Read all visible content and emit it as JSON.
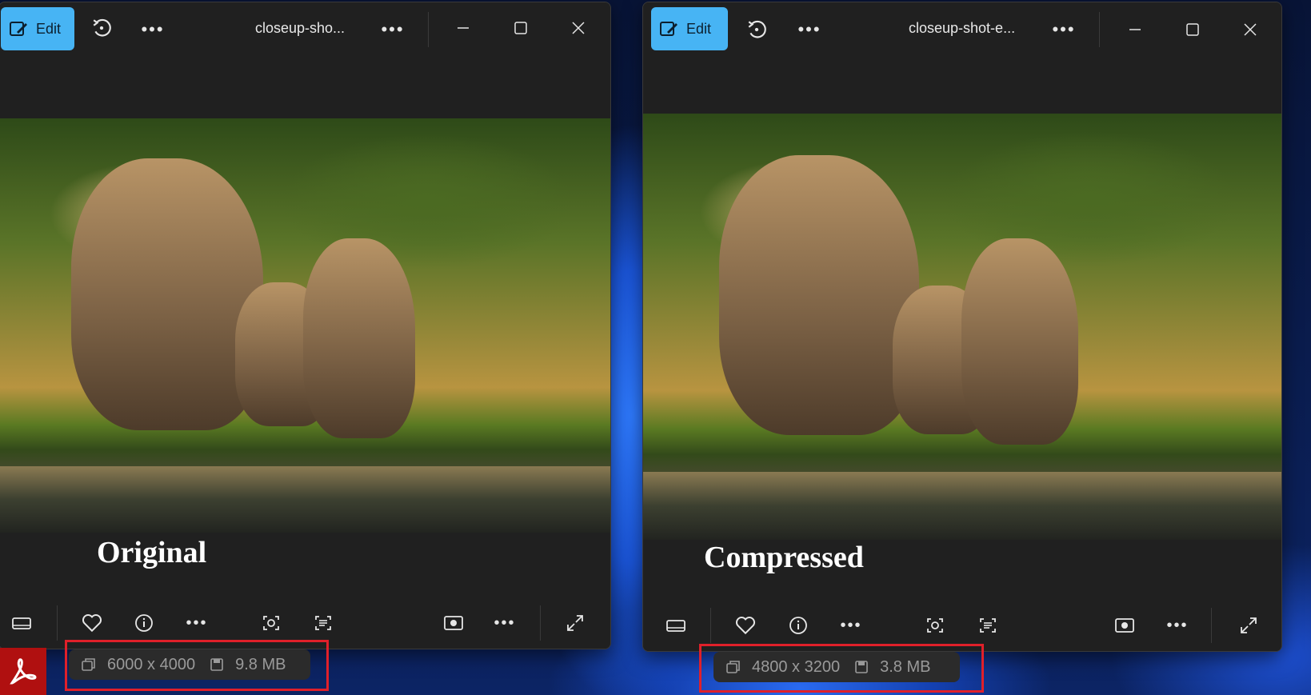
{
  "windows": [
    {
      "edit_label": "Edit",
      "title": "closeup-sho...",
      "caption": "Original",
      "info": {
        "dimensions": "6000 x 4000",
        "size": "9.8 MB"
      }
    },
    {
      "edit_label": "Edit",
      "title": "closeup-shot-e...",
      "caption": "Compressed",
      "info": {
        "dimensions": "4800 x 3200",
        "size": "3.8 MB"
      }
    }
  ],
  "colors": {
    "edit_button": "#47b4f4",
    "window_bg": "#202020",
    "highlight_box": "#e0202a"
  },
  "icons": [
    "edit-icon",
    "rotate-icon",
    "more-icon",
    "minimize-icon",
    "maximize-icon",
    "close-icon",
    "filmstrip-icon",
    "heart-icon",
    "info-icon",
    "face-scan-icon",
    "text-scan-icon",
    "slideshow-icon",
    "expand-icon",
    "dimensions-icon",
    "save-icon",
    "acrobat-icon"
  ]
}
